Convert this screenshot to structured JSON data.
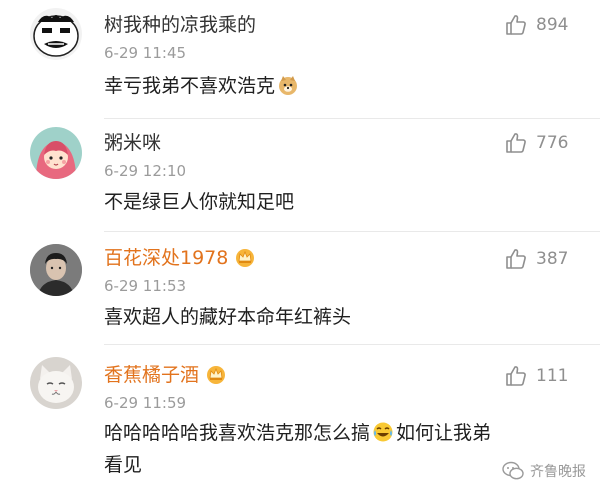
{
  "comments": [
    {
      "username": "树我种的凉我乘的",
      "timestamp": "6-29 11:45",
      "text": "幸亏我弟不喜欢浩克",
      "likes": "894",
      "avatar_icon": "meme-face-avatar-icon",
      "vip": false
    },
    {
      "username": "粥米咪",
      "timestamp": "6-29 12:10",
      "text": "不是绿巨人你就知足吧",
      "likes": "776",
      "avatar_icon": "cartoon-girl-avatar-icon",
      "vip": false
    },
    {
      "username": "百花深处1978",
      "timestamp": "6-29 11:53",
      "text": "喜欢超人的藏好本命年红裤头",
      "likes": "387",
      "avatar_icon": "photo-portrait-avatar-icon",
      "vip": true
    },
    {
      "username": "香蕉橘子酒",
      "timestamp": "6-29 11:59",
      "text_part1": "哈哈哈哈哈我喜欢浩克那怎么搞",
      "text_part2": "如何让我弟",
      "text_part3": "看见",
      "likes": "111",
      "avatar_icon": "white-cat-avatar-icon",
      "vip": true
    }
  ],
  "watermark": "齐鲁晚报",
  "colors": {
    "vip_name": "#e2731d",
    "timestamp": "#9b9b9b",
    "like": "#8f8f8f"
  }
}
